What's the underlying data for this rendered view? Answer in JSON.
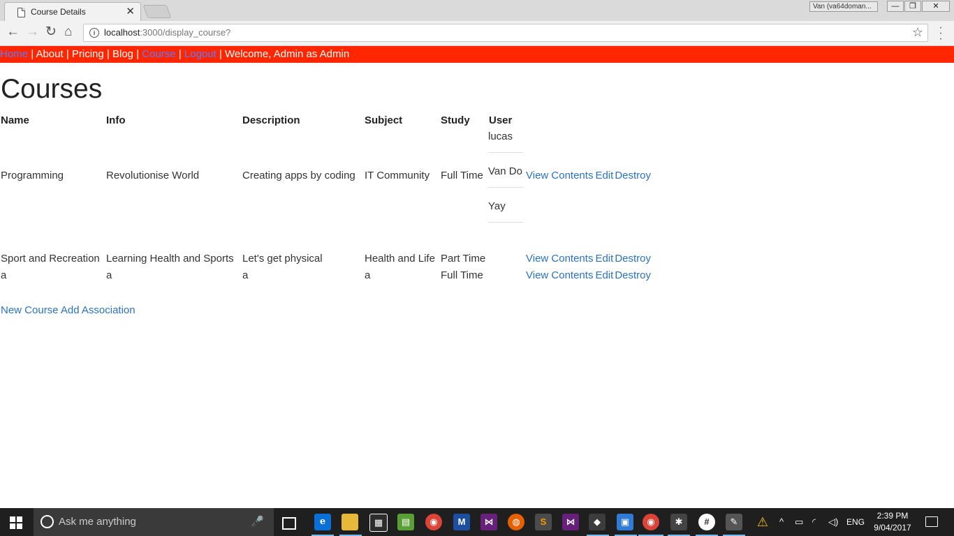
{
  "browser": {
    "tab_title": "Course Details",
    "tab_close": "✕",
    "profile_label": "Van (va64doman...",
    "url_host": "localhost",
    "url_path": ":3000/display_course?"
  },
  "nav": {
    "home": "Home",
    "about": "About",
    "pricing": "Pricing",
    "blog": "Blog",
    "course": "Course",
    "logout": "Logout",
    "welcome": "Welcome, Admin as Admin",
    "separator": "|"
  },
  "page": {
    "title": "Courses",
    "columns": [
      "Name",
      "Info",
      "Description",
      "Subject",
      "Study",
      "User"
    ],
    "rows": [
      {
        "name": "Programming",
        "info": "Revolutionise World",
        "description": "Creating apps by coding",
        "subject": "IT Community",
        "study": "Full Time",
        "users": [
          "lucas",
          "Van Do",
          "Yay"
        ],
        "view": "View Contents",
        "edit": "Edit",
        "destroy": "Destroy"
      },
      {
        "name": "Sport and Recreation",
        "info": "Learning Health and Sports",
        "description": "Let's get physical",
        "subject": "Health and Life",
        "study": "Part Time",
        "users": [],
        "view": "View Contents",
        "edit": "Edit",
        "destroy": "Destroy"
      },
      {
        "name": "a",
        "info": "a",
        "description": "a",
        "subject": "a",
        "study": "Full Time",
        "users": [],
        "view": "View Contents",
        "edit": "Edit",
        "destroy": "Destroy"
      }
    ],
    "new_course": "New Course",
    "add_association": "Add Association"
  },
  "taskbar": {
    "search_placeholder": "Ask me anything",
    "language": "ENG",
    "time": "2:39 PM",
    "date": "9/04/2017"
  },
  "colors": {
    "nav_bar": "#ff2600",
    "link": "#2a73c0",
    "nav_link": "#5b79ff"
  }
}
